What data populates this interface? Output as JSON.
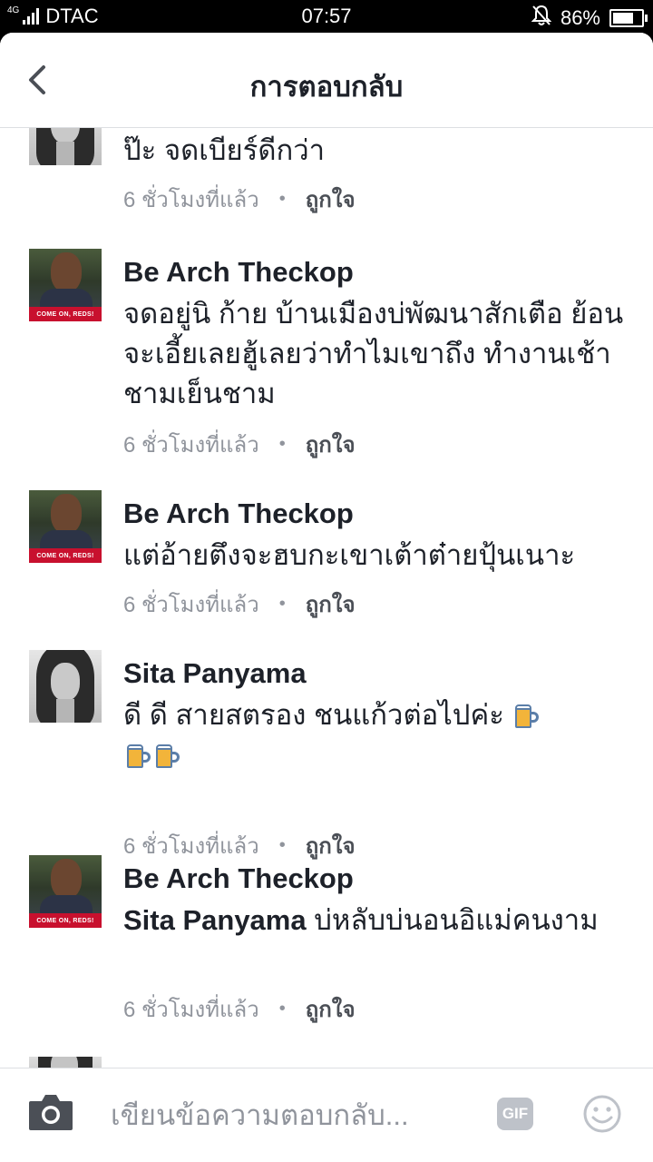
{
  "status_bar": {
    "network": "4G",
    "carrier": "DTAC",
    "time": "07:57",
    "battery_percent": "86%",
    "battery_level": 0.86,
    "icons": [
      "signal-icon",
      "notifications-muted-icon",
      "battery-icon"
    ]
  },
  "header": {
    "title": "การตอบกลับ",
    "back_icon": "chevron-left-icon"
  },
  "comments": [
    {
      "author": "",
      "text": "ป๊ะ จดเบียร์ดีกว่า",
      "time": "6 ชั่วโมงที่แล้ว",
      "separator": "•",
      "like_label": "ถูกใจ"
    },
    {
      "author": "Be Arch Theckop",
      "text": "จดอยู่นิ ก้าย บ้านเมืองบ่พัฒนาสักเตือ ย้อนจะเอี้ยเลยฮู้เลยว่าทำไมเขาถึง ทำงานเช้าชามเย็นชาม",
      "time": "6 ชั่วโมงที่แล้ว",
      "separator": "•",
      "like_label": "ถูกใจ"
    },
    {
      "author": "Be Arch Theckop",
      "text": "แต่อ้ายตึงจะฮบกะเขาเต้าต๋ายปุ้นเนาะ",
      "time": "6 ชั่วโมงที่แล้ว",
      "separator": "•",
      "like_label": "ถูกใจ"
    },
    {
      "author": "Sita Panyama",
      "text": "ดี ดี สายสตรอง ชนแก้วต่อไปค่ะ",
      "emoji": "beer-mug-icon",
      "emoji_count": 3,
      "time": "6 ชั่วโมงที่แล้ว",
      "separator": "•",
      "like_label": "ถูกใจ"
    },
    {
      "author": "Be Arch Theckop",
      "mention": "Sita Panyama",
      "text": " บ่หลับบ่นอนอิแม่คนงาม",
      "time": "6 ชั่วโมงที่แล้ว",
      "separator": "•",
      "like_label": "ถูกใจ"
    }
  ],
  "avatar_badge": "COME ON, REDS!",
  "composer": {
    "placeholder": "เขียนข้อความตอบกลับ...",
    "gif_label": "GIF",
    "camera_icon": "camera-icon",
    "emoji_icon": "smiley-icon"
  },
  "colors": {
    "text": "#1d2129",
    "secondary": "#90949c",
    "divider": "#dddfe2",
    "badge_red": "#c8102e"
  }
}
